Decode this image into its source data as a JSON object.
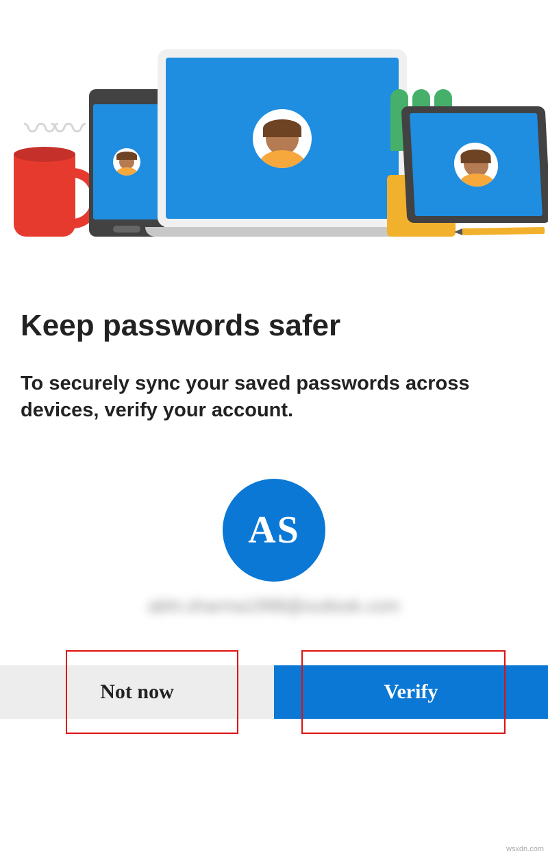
{
  "page": {
    "title": "Keep passwords safer",
    "description": "To securely sync your saved passwords across devices, verify your account."
  },
  "account": {
    "initials": "AS",
    "email": "abhi.sharma1998@outlook.com"
  },
  "buttons": {
    "not_now": "Not now",
    "verify": "Verify"
  },
  "footer": {
    "watermark": "wsxdn.com"
  },
  "colors": {
    "primary": "#0a78d4",
    "secondary_bg": "#ededed",
    "highlight": "#d11"
  }
}
